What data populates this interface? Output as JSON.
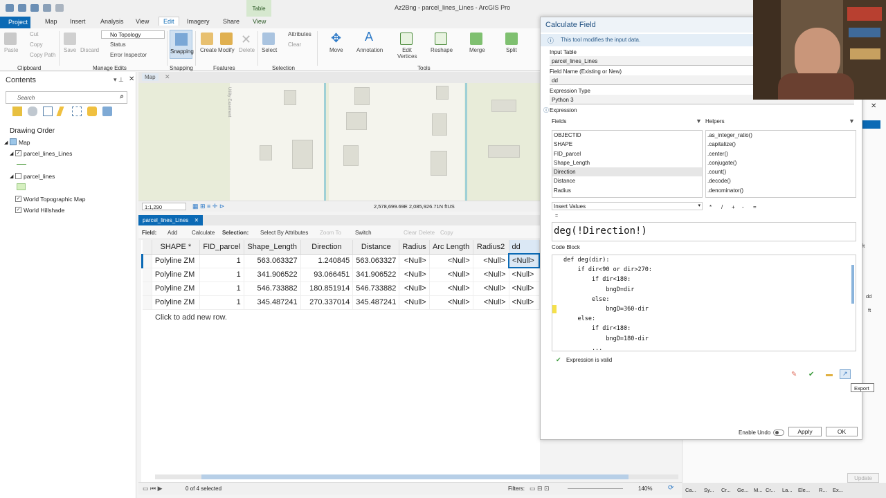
{
  "app": {
    "title": "Az2Bng - parcel_lines_Lines - ArcGIS Pro",
    "contextual_tab": "Table"
  },
  "tabs": [
    "Project",
    "Map",
    "Insert",
    "Analysis",
    "View",
    "Edit",
    "Imagery",
    "Share",
    "View"
  ],
  "ribbon": {
    "clipboard": {
      "paste": "Paste",
      "cut": "Cut",
      "copy": "Copy",
      "copy_path": "Copy Path",
      "group": "Clipboard"
    },
    "manage_edits": {
      "save": "Save",
      "discard": "Discard",
      "topology": "No Topology",
      "status": "Status",
      "error_inspector": "Error Inspector",
      "group": "Manage Edits"
    },
    "snapping": {
      "label": "Snapping",
      "group": "Snapping"
    },
    "features": {
      "create": "Create",
      "modify": "Modify",
      "delete": "Delete",
      "group": "Features"
    },
    "selection": {
      "select": "Select",
      "attributes": "Attributes",
      "clear": "Clear",
      "group": "Selection"
    },
    "tools": {
      "move": "Move",
      "annotation": "Annotation",
      "edit_vertices": "Edit Vertices",
      "reshape": "Reshape",
      "merge": "Merge",
      "split": "Split",
      "group": "Tools"
    }
  },
  "contents": {
    "title": "Contents",
    "search_placeholder": "Search",
    "drawing_order": "Drawing Order",
    "map": "Map",
    "layers": [
      "parcel_lines_Lines",
      "parcel_lines",
      "World Topographic Map",
      "World Hillshade"
    ]
  },
  "map": {
    "tab": "Map",
    "scale": "1:1,290",
    "coords": "2,578,699.69E 2,085,926.71N ftUS",
    "street": "Utility Easement"
  },
  "table": {
    "tab": "parcel_lines_Lines",
    "toolbar": {
      "field": "Field:",
      "add": "Add",
      "calculate": "Calculate",
      "selection": "Selection:",
      "select_by_attr": "Select By Attributes",
      "zoom_to": "Zoom To",
      "switch": "Switch",
      "clear": "Clear",
      "delete": "Delete",
      "copy": "Copy"
    },
    "columns": [
      "SHAPE *",
      "FID_parcel",
      "Shape_Length",
      "Direction",
      "Distance",
      "Radius",
      "Arc Length",
      "Radius2",
      "dd"
    ],
    "rows": [
      [
        "Polyline ZM",
        "1",
        "563.063327",
        "1.240845",
        "563.063327",
        "<Null>",
        "<Null>",
        "<Null>",
        "<Null>"
      ],
      [
        "Polyline ZM",
        "1",
        "341.906522",
        "93.066451",
        "341.906522",
        "<Null>",
        "<Null>",
        "<Null>",
        "<Null>"
      ],
      [
        "Polyline ZM",
        "1",
        "546.733882",
        "180.851914",
        "546.733882",
        "<Null>",
        "<Null>",
        "<Null>",
        "<Null>"
      ],
      [
        "Polyline ZM",
        "1",
        "345.487241",
        "270.337014",
        "345.487241",
        "<Null>",
        "<Null>",
        "<Null>",
        "<Null>"
      ]
    ],
    "add_row": "Click to add new row.",
    "selected": "0 of 4 selected",
    "filters": "Filters:",
    "zoom": "140%"
  },
  "dialog": {
    "title": "Calculate Field",
    "info": "This tool modifies the input data.",
    "input_table_label": "Input Table",
    "input_table": "parcel_lines_Lines",
    "field_name_label": "Field Name (Existing or New)",
    "field_name": "dd",
    "expr_type_label": "Expression Type",
    "expr_type": "Python 3",
    "expression_label": "Expression",
    "fields_label": "Fields",
    "helpers_label": "Helpers",
    "fields": [
      "OBJECTID",
      "SHAPE",
      "FID_parcel",
      "Shape_Length",
      "Direction",
      "Distance",
      "Radius"
    ],
    "helpers": [
      ".as_integer_ratio()",
      ".capitalize()",
      ".center()",
      ".conjugate()",
      ".count()",
      ".decode()",
      ".denominator()"
    ],
    "insert_values": "Insert Values",
    "operators": [
      "*",
      "/",
      "+",
      "-",
      "="
    ],
    "eq_second": "=",
    "expression": "deg(!Direction!)",
    "code_block_label": "Code Block",
    "code": [
      "def deg(dir):",
      "    if dir<90 or dir>270:",
      "        if dir<180:",
      "            bngD=dir",
      "        else:",
      "            bngD=360-dir",
      "    else:",
      "        if dir<180:",
      "            bngD=180-dir",
      "        ..."
    ],
    "valid": "Expression is valid",
    "tooltip": "Export",
    "enable_undo": "Enable Undo",
    "apply": "Apply",
    "ok": "OK"
  },
  "right_pane": {
    "update": "Update",
    "units": "ft",
    "dd": "dd"
  },
  "taskbar": [
    "Ca...",
    "Sy...",
    "Cr...",
    "Ge...",
    "M...",
    "Cr...",
    "La...",
    "Ele...",
    "R...",
    "Ex..."
  ],
  "colors": {
    "accent": "#0b6ab5",
    "valid": "#3a9a3a"
  }
}
